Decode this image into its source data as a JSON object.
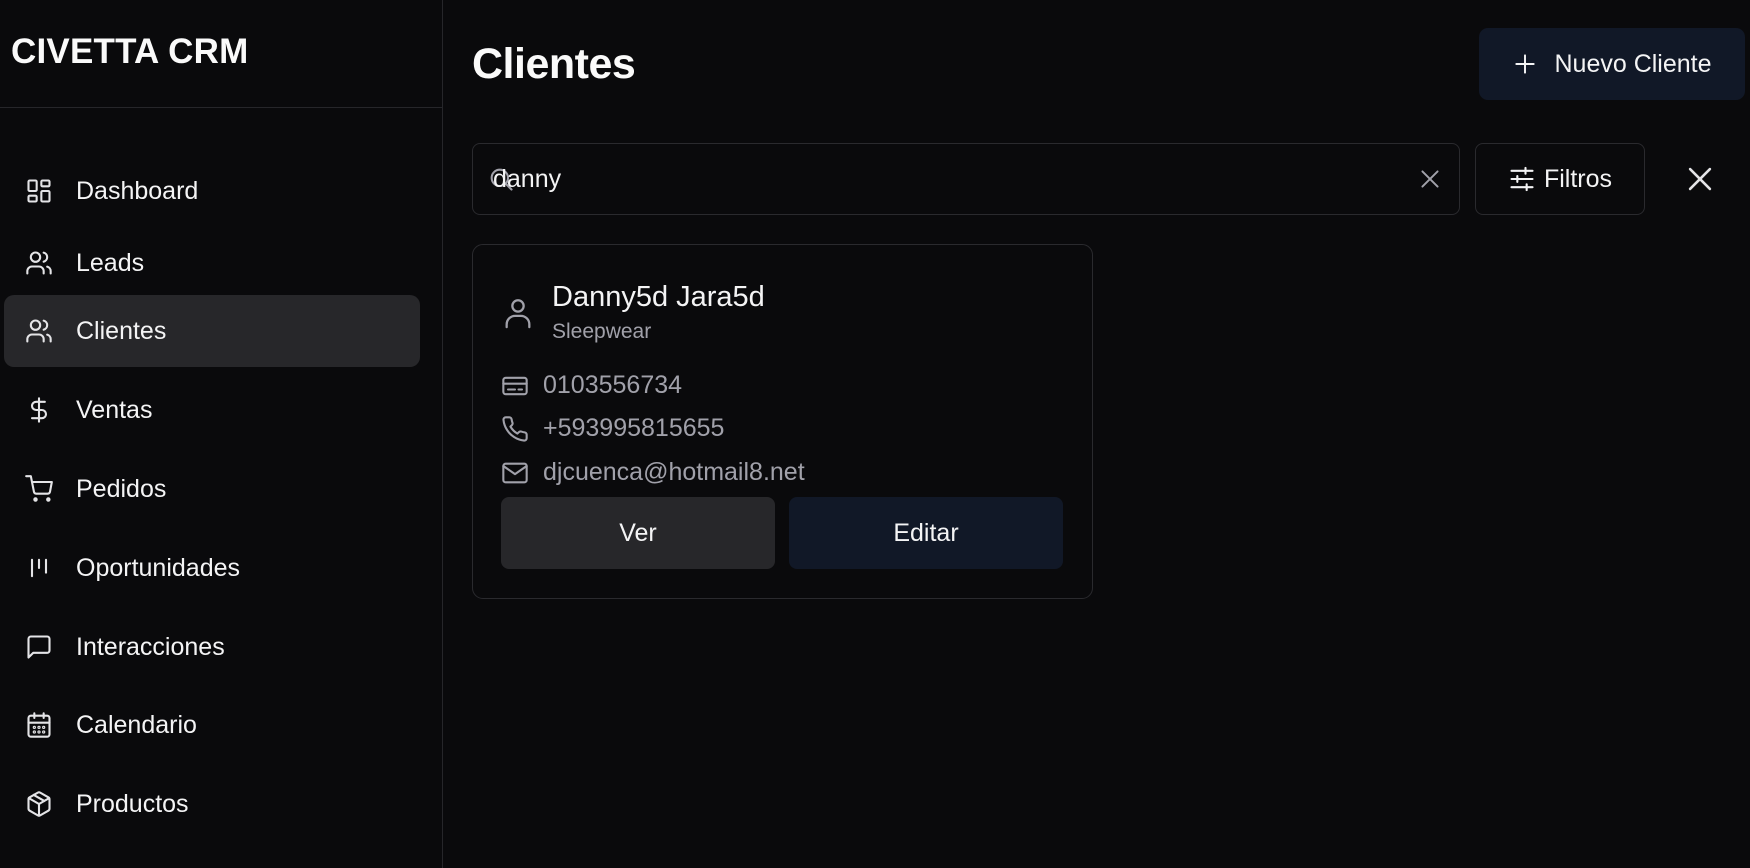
{
  "app": {
    "brand": "CIVETTA CRM"
  },
  "sidebar": {
    "items": [
      {
        "label": "Dashboard",
        "icon": "dashboard-icon",
        "active": false
      },
      {
        "label": "Leads",
        "icon": "users-icon",
        "active": false
      },
      {
        "label": "Clientes",
        "icon": "users-icon",
        "active": true
      },
      {
        "label": "Ventas",
        "icon": "dollar-icon",
        "active": false
      },
      {
        "label": "Pedidos",
        "icon": "cart-icon",
        "active": false
      },
      {
        "label": "Oportunidades",
        "icon": "kanban-icon",
        "active": false
      },
      {
        "label": "Interacciones",
        "icon": "message-icon",
        "active": false
      },
      {
        "label": "Calendario",
        "icon": "calendar-icon",
        "active": false
      },
      {
        "label": "Productos",
        "icon": "package-icon",
        "active": false
      }
    ]
  },
  "header": {
    "title": "Clientes",
    "new_button_label": "Nuevo Cliente"
  },
  "search": {
    "value": "danny",
    "placeholder": ""
  },
  "filters": {
    "label": "Filtros"
  },
  "results": [
    {
      "name": "Danny5d Jara5d",
      "company": "Sleepwear",
      "id_number": "0103556734",
      "phone": "+593995815655",
      "email": "djcuenca@hotmail8.net",
      "view_label": "Ver",
      "edit_label": "Editar"
    }
  ],
  "colors": {
    "background": "#0a0a0c",
    "active_item": "#27272a",
    "primary_button": "#111827",
    "muted_text": "#a1a1aa"
  }
}
